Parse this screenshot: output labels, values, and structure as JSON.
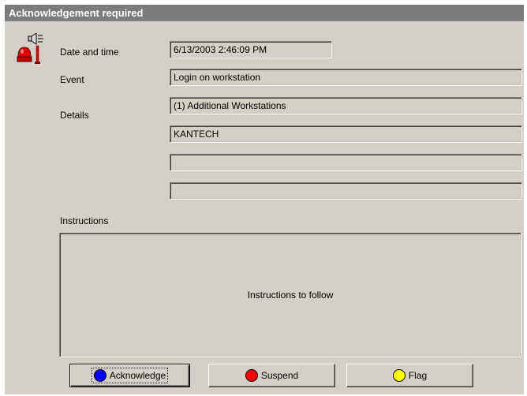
{
  "window": {
    "title": "Acknowledgement required"
  },
  "fields": {
    "date_label": "Date and time",
    "date_value": "6/13/2003 2:46:09 PM",
    "event_label": "Event",
    "event_value": "Login on workstation",
    "details_label": "Details",
    "details_lines": [
      "(1)  Additional Workstations",
      "KANTECH",
      "",
      ""
    ]
  },
  "instructions": {
    "label": "Instructions",
    "text": "Instructions to follow"
  },
  "buttons": {
    "acknowledge": {
      "label": "Acknowledge",
      "color": "#0000ff"
    },
    "suspend": {
      "label": "Suspend",
      "color": "#ff0000"
    },
    "flag": {
      "label": "Flag",
      "color": "#ffff00"
    }
  },
  "icons": {
    "alarm": "alarm-bell-icon"
  }
}
